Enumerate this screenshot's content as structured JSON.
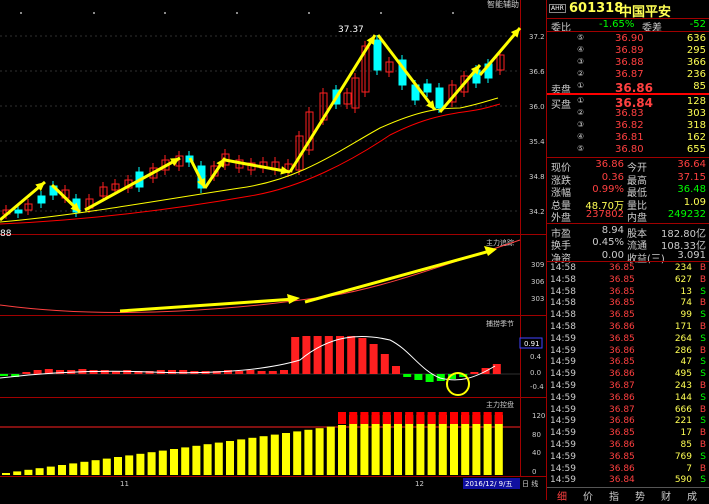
{
  "chart": {
    "indicator_label": "智能辅助",
    "high_label": "37.37",
    "low_left_label": "88",
    "price_ticks": [
      "37.2",
      "36.6",
      "36.0",
      "35.4",
      "34.8",
      "34.2"
    ],
    "track_title": "主力追踪",
    "track_ticks": [
      "309",
      "306",
      "303"
    ],
    "season_title": "捕捞季节",
    "season_value": "0.91",
    "season_ticks": [
      "0.4",
      "0.0",
      "-0.4"
    ],
    "control_title": "主力控盘",
    "control_ticks": [
      "120",
      "80",
      "40",
      "0"
    ],
    "x_labels": [
      "11",
      "12"
    ],
    "date_label": "2016/12/ 9/五",
    "date_label2": "日 线",
    "colors": {
      "up": "#ff2020",
      "down": "#00ffff",
      "arrow": "#ffff00",
      "ma1": "#ffff00",
      "ma2": "#ff0000",
      "bar_yellow": "#ffff00",
      "bar_red": "#ff0000"
    }
  },
  "quote": {
    "badge": "AHR",
    "code": "601318",
    "name": "中国平安",
    "weibi_label": "委比",
    "weibi_value": "-1.65%",
    "weicha_label": "委差",
    "weicha_value": "-52",
    "sell_label": "卖盘",
    "buy_label": "买盘",
    "sells": [
      {
        "lvl": "⑤",
        "price": "36.90",
        "vol": "636"
      },
      {
        "lvl": "④",
        "price": "36.89",
        "vol": "295"
      },
      {
        "lvl": "③",
        "price": "36.88",
        "vol": "366"
      },
      {
        "lvl": "②",
        "price": "36.87",
        "vol": "236"
      },
      {
        "lvl": "①",
        "price": "36.86",
        "vol": "85"
      }
    ],
    "buys": [
      {
        "lvl": "①",
        "price": "36.84",
        "vol": "128"
      },
      {
        "lvl": "②",
        "price": "36.83",
        "vol": "303"
      },
      {
        "lvl": "③",
        "price": "36.82",
        "vol": "318"
      },
      {
        "lvl": "④",
        "price": "36.81",
        "vol": "162"
      },
      {
        "lvl": "⑤",
        "price": "36.80",
        "vol": "655"
      }
    ],
    "stats": [
      {
        "l1": "现价",
        "v1": "36.86",
        "l2": "今开",
        "v2": "36.64"
      },
      {
        "l1": "涨跌",
        "v1": "0.36",
        "l2": "最高",
        "v2": "37.15"
      },
      {
        "l1": "涨幅",
        "v1": "0.99%",
        "l2": "最低",
        "v2": "36.48"
      },
      {
        "l1": "总量",
        "v1": "48.70万",
        "l2": "量比",
        "v2": "1.09"
      },
      {
        "l1": "外盘",
        "v1": "237802",
        "l2": "内盘",
        "v2": "249232"
      }
    ],
    "stats2": [
      {
        "l1": "市盈",
        "v1": "8.94",
        "l2": "股本",
        "v2": "182.80亿"
      },
      {
        "l1": "换手",
        "v1": "0.45%",
        "l2": "流通",
        "v2": "108.33亿"
      },
      {
        "l1": "净资",
        "v1": "0.00",
        "l2": "收益(三)",
        "v2": "3.091"
      }
    ],
    "ticks": [
      {
        "t": "14:58",
        "p": "36.85",
        "v": "234",
        "d": "B"
      },
      {
        "t": "14:58",
        "p": "36.85",
        "v": "627",
        "d": "B"
      },
      {
        "t": "14:58",
        "p": "36.85",
        "v": "13",
        "d": "S"
      },
      {
        "t": "14:58",
        "p": "36.85",
        "v": "74",
        "d": "B"
      },
      {
        "t": "14:58",
        "p": "36.85",
        "v": "99",
        "d": "S"
      },
      {
        "t": "14:58",
        "p": "36.86",
        "v": "171",
        "d": "B"
      },
      {
        "t": "14:59",
        "p": "36.85",
        "v": "264",
        "d": "S"
      },
      {
        "t": "14:59",
        "p": "36.86",
        "v": "286",
        "d": "B"
      },
      {
        "t": "14:59",
        "p": "36.85",
        "v": "47",
        "d": "S"
      },
      {
        "t": "14:59",
        "p": "36.86",
        "v": "495",
        "d": "S"
      },
      {
        "t": "14:59",
        "p": "36.87",
        "v": "243",
        "d": "B"
      },
      {
        "t": "14:59",
        "p": "36.86",
        "v": "144",
        "d": "S"
      },
      {
        "t": "14:59",
        "p": "36.87",
        "v": "666",
        "d": "B"
      },
      {
        "t": "14:59",
        "p": "36.86",
        "v": "221",
        "d": "S"
      },
      {
        "t": "14:59",
        "p": "36.85",
        "v": "17",
        "d": "B"
      },
      {
        "t": "14:59",
        "p": "36.86",
        "v": "85",
        "d": "B"
      },
      {
        "t": "14:59",
        "p": "36.85",
        "v": "769",
        "d": "S"
      },
      {
        "t": "14:59",
        "p": "36.86",
        "v": "7",
        "d": "B"
      },
      {
        "t": "14:59",
        "p": "36.84",
        "v": "590",
        "d": "S"
      }
    ],
    "tabs": [
      "细",
      "价",
      "指",
      "势",
      "财",
      "成"
    ]
  }
}
